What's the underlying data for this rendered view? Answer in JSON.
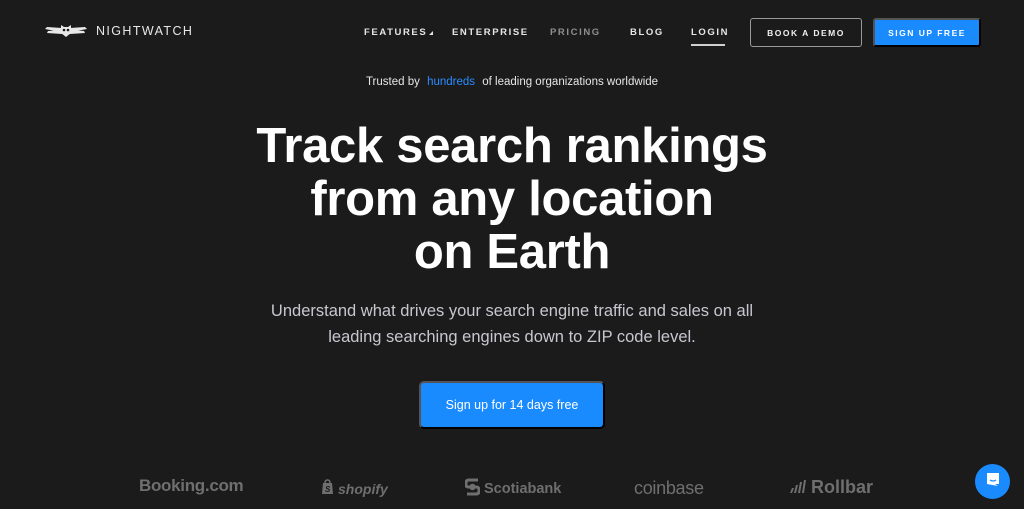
{
  "brand": {
    "name": "NIGHTWATCH",
    "logo_icon": "owl-wings-icon"
  },
  "nav": {
    "links": [
      {
        "label": "FEATURES",
        "has_dropdown": true
      },
      {
        "label": "ENTERPRISE"
      },
      {
        "label": "PRICING"
      },
      {
        "label": "BLOG"
      },
      {
        "label": "LOGIN",
        "active": true
      }
    ],
    "book_demo": "BOOK A DEMO",
    "sign_up": "SIGN UP FREE"
  },
  "hero": {
    "trusted_prefix": "Trusted by",
    "trusted_highlight": "hundreds",
    "trusted_suffix": "of leading organizations worldwide",
    "headline_lines": [
      "Track search rankings",
      "from any location",
      "on Earth"
    ],
    "subtitle_lines": [
      "Understand what drives your search engine traffic and sales on all",
      "leading searching engines down to ZIP code level."
    ],
    "cta": "Sign up for 14 days free"
  },
  "customer_logos": [
    "Booking.com",
    "shopify",
    "Scotiabank",
    "coinbase",
    "Rollbar"
  ],
  "chat_widget": {
    "icon": "chat-bubble-icon"
  },
  "colors": {
    "accent": "#1a8bff",
    "background": "#1b1b1c",
    "logo_gray": "#6f6f6f"
  }
}
